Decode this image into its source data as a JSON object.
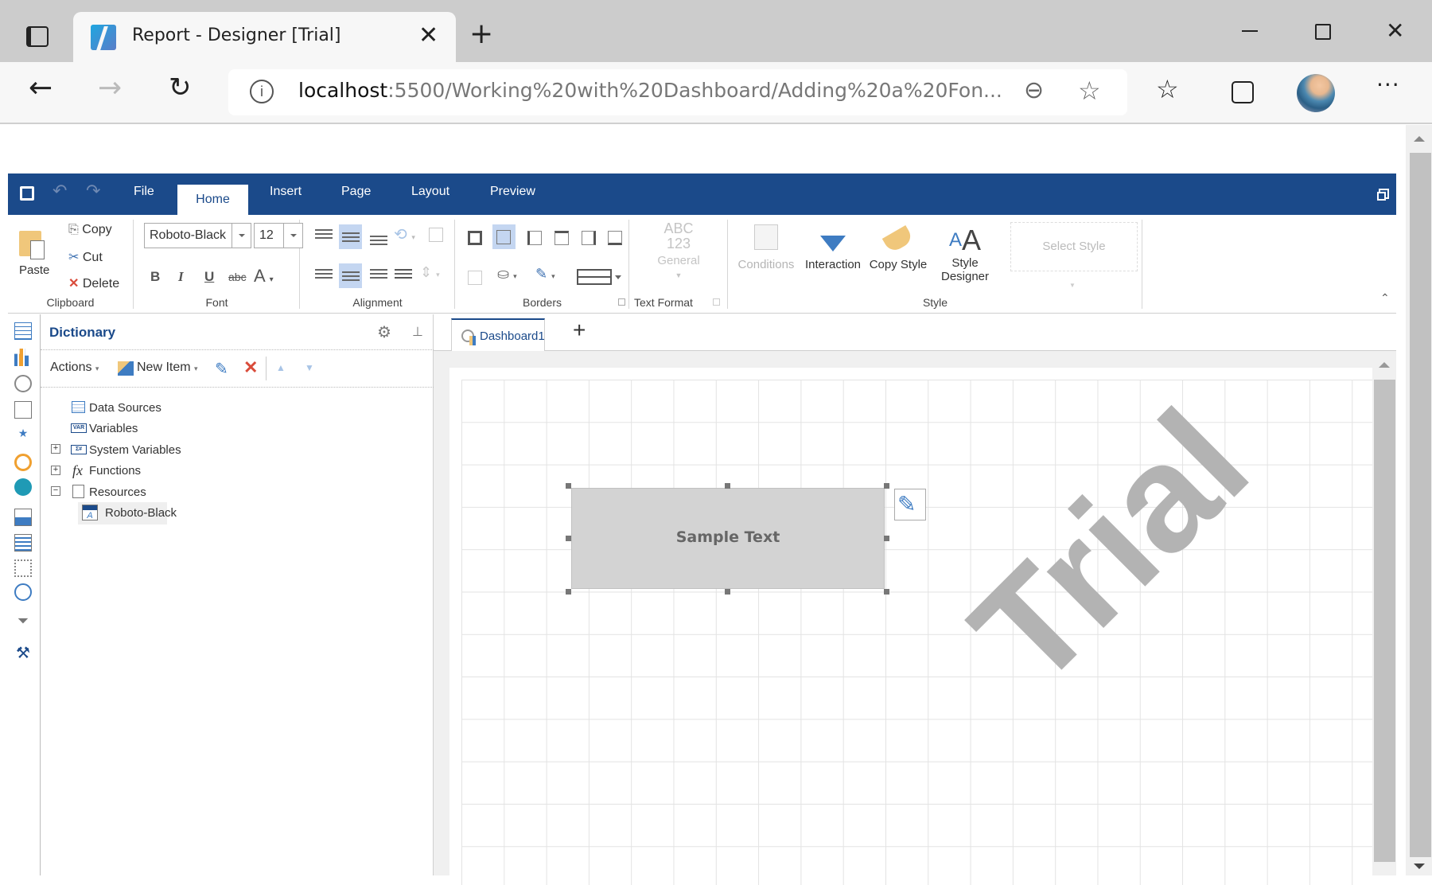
{
  "browser": {
    "tab_title": "Report - Designer [Trial]",
    "url_host": "localhost",
    "url_rest": ":5500/Working%20with%20Dashboard/Adding%20a%20Fon...",
    "icons": [
      "tab-actions-icon",
      "close-tab-icon",
      "new-tab-icon",
      "minimize-icon",
      "maximize-icon",
      "close-window-icon",
      "back-icon",
      "forward-icon",
      "refresh-icon",
      "site-info-icon",
      "zoom-out-icon",
      "add-favorite-icon",
      "favorites-icon",
      "collections-icon",
      "profile-avatar",
      "more-icon"
    ]
  },
  "ribbon": {
    "tabs": [
      "File",
      "Home",
      "Insert",
      "Page",
      "Layout",
      "Preview"
    ],
    "active_tab": "Home",
    "clipboard": {
      "label": "Clipboard",
      "paste": "Paste",
      "copy": "Copy",
      "cut": "Cut",
      "delete": "Delete"
    },
    "font": {
      "label": "Font",
      "family": "Roboto-Black",
      "size": "12",
      "bold": "B",
      "italic": "I",
      "underline": "U",
      "strike": "abc",
      "color": "A"
    },
    "alignment": {
      "label": "Alignment"
    },
    "borders": {
      "label": "Borders"
    },
    "text_format": {
      "label": "Text Format",
      "abc": "ABC",
      "num": "123",
      "general": "General"
    },
    "style": {
      "label": "Style",
      "conditions": "Conditions",
      "interaction": "Interaction",
      "copy_style": "Copy Style",
      "style_designer_1": "Style",
      "style_designer_2": "Designer",
      "select_style": "Select Style"
    }
  },
  "dictionary": {
    "title": "Dictionary",
    "actions": "Actions",
    "new_item": "New Item",
    "tree": [
      {
        "label": "Data Sources",
        "icon": "data-sources-icon",
        "expander": ""
      },
      {
        "label": "Variables",
        "icon": "variables-icon",
        "expander": ""
      },
      {
        "label": "System Variables",
        "icon": "system-variables-icon",
        "expander": "+"
      },
      {
        "label": "Functions",
        "icon": "functions-icon",
        "expander": "+"
      },
      {
        "label": "Resources",
        "icon": "resources-icon",
        "expander": "−"
      },
      {
        "label": "Roboto-Black",
        "icon": "ttf-font-icon",
        "expander": "",
        "selected": true
      }
    ]
  },
  "designer": {
    "tab": "Dashboard1",
    "element_text": "Sample Text",
    "watermark": "Trial"
  },
  "colors": {
    "accent": "#1b4a8a",
    "highlight": "#c4d6f1",
    "element_fill": "#d3d3d3",
    "watermark": "#b3b3b3"
  }
}
